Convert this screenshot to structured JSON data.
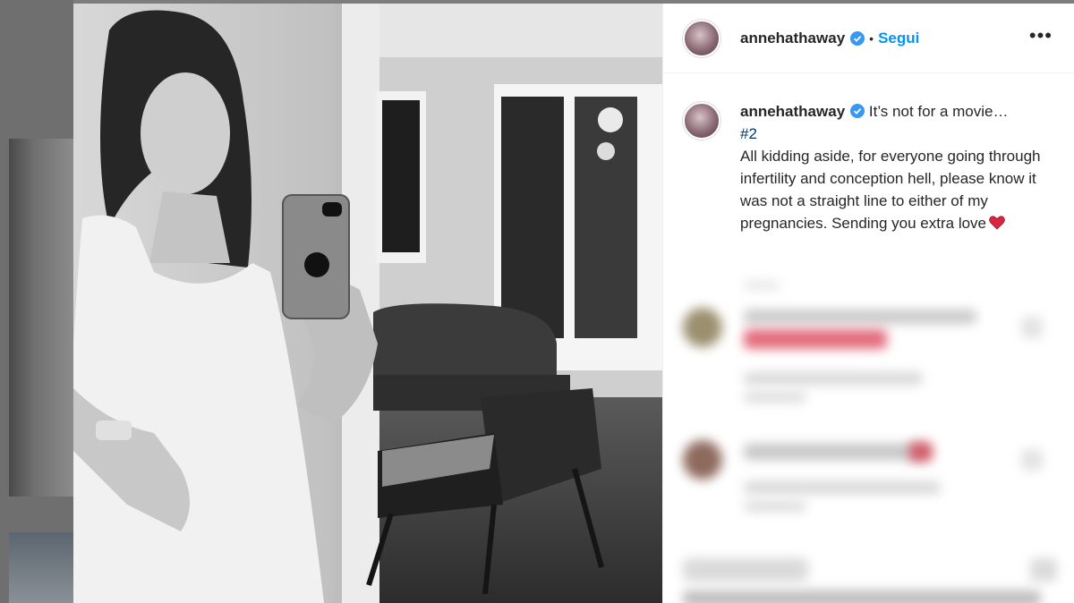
{
  "post": {
    "username": "annehathaway",
    "follow_separator": "•",
    "follow_label": "Segui",
    "more_label": "•••"
  },
  "caption": {
    "username": "annehathaway",
    "line1": "It’s not for a movie…",
    "hashtag": "#2",
    "body": "All kidding aside, for everyone going through infertility and conception hell, please know it was not a straight line to either of my pregnancies. Sending you extra love"
  },
  "icons": {
    "verified": "verified-badge-icon",
    "heart": "red-heart-icon",
    "more": "more-options-icon"
  },
  "colors": {
    "accent": "#0095f6",
    "verified": "#3897f0",
    "heart": "#d7263d",
    "text": "#262626"
  }
}
